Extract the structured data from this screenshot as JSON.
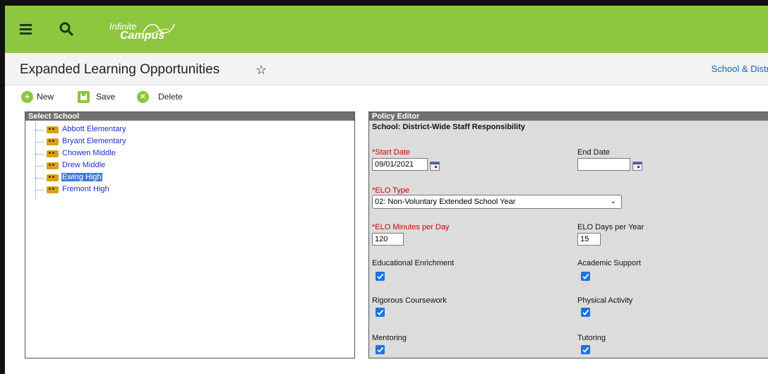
{
  "app": {
    "logo_line1": "Infinite",
    "logo_line2": "Campus"
  },
  "header": {
    "title": "Expanded Learning Opportunities",
    "star_glyph": "☆",
    "link": "School & Distr"
  },
  "toolbar": {
    "new_label": "New",
    "save_label": "Save",
    "delete_label": "Delete"
  },
  "select_school": {
    "title": "Select School",
    "schools": [
      "Abbott Elementary",
      "Bryant Elementary",
      "Chowen Middle",
      "Drew Middle",
      "Ewing High",
      "Fremont High"
    ],
    "selected": "Ewing High"
  },
  "policy_editor": {
    "title": "Policy Editor",
    "subtitle": "School: District-Wide Staff Responsibility",
    "start_date_label": "*Start Date",
    "start_date_value": "09/01/2021",
    "end_date_label": "End Date",
    "end_date_value": "",
    "elo_type_label": "*ELO Type",
    "elo_type_value": "02: Non-Voluntary Extended School Year",
    "minutes_label": "*ELO Minutes per Day",
    "minutes_value": "120",
    "days_label": "ELO Days per Year",
    "days_value": "15",
    "checkboxes": [
      {
        "label": "Educational Enrichment",
        "checked": true
      },
      {
        "label": "Academic Support",
        "checked": true
      },
      {
        "label": "Rigorous Coursework",
        "checked": true
      },
      {
        "label": "Physical Activity",
        "checked": true
      },
      {
        "label": "Mentoring",
        "checked": true
      },
      {
        "label": "Tutoring",
        "checked": true
      }
    ]
  },
  "colors": {
    "brand_green": "#8dc63f",
    "link_blue": "#1564b9",
    "required_red": "#d40000",
    "checkbox_blue": "#1a73e8"
  },
  "icons": [
    "menu-icon",
    "search-icon",
    "star-icon",
    "new-icon",
    "save-icon",
    "delete-icon",
    "school-bus-icon",
    "calendar-icon",
    "chevron-down-icon",
    "checkmark-icon"
  ]
}
